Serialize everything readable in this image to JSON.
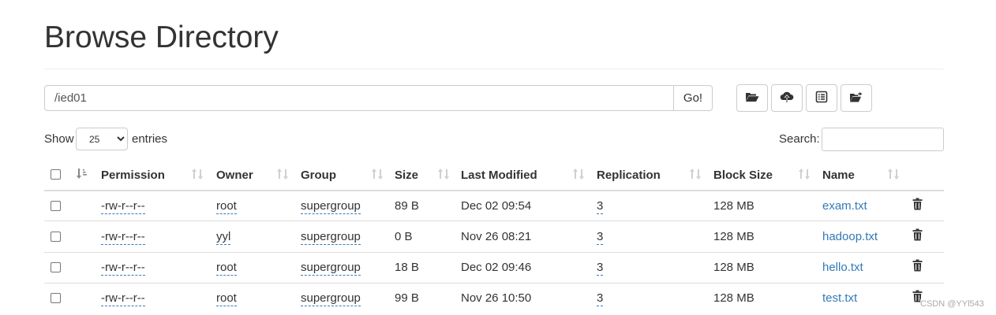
{
  "page": {
    "title": "Browse Directory"
  },
  "toolbar": {
    "path_value": "/ied01",
    "go_label": "Go!",
    "buttons": [
      {
        "name": "create-directory-button",
        "icon": "folder-open-icon"
      },
      {
        "name": "upload-button",
        "icon": "cloud-upload-icon"
      },
      {
        "name": "cut-paste-button",
        "icon": "list-alt-icon"
      },
      {
        "name": "paste-button",
        "icon": "folder-move-icon"
      }
    ]
  },
  "controls": {
    "show_label": "Show",
    "entries_label": "entries",
    "page_length": "25",
    "page_length_options": [
      "25"
    ],
    "search_label": "Search:",
    "search_value": ""
  },
  "table": {
    "headers": {
      "permission": "Permission",
      "owner": "Owner",
      "group": "Group",
      "size": "Size",
      "last_modified": "Last Modified",
      "replication": "Replication",
      "block_size": "Block Size",
      "name": "Name"
    },
    "rows": [
      {
        "permission": "-rw-r--r--",
        "owner": "root",
        "group": "supergroup",
        "size": "89 B",
        "last_modified": "Dec 02 09:54",
        "replication": "3",
        "block_size": "128 MB",
        "name": "exam.txt"
      },
      {
        "permission": "-rw-r--r--",
        "owner": "yyl",
        "group": "supergroup",
        "size": "0 B",
        "last_modified": "Nov 26 08:21",
        "replication": "3",
        "block_size": "128 MB",
        "name": "hadoop.txt"
      },
      {
        "permission": "-rw-r--r--",
        "owner": "root",
        "group": "supergroup",
        "size": "18 B",
        "last_modified": "Dec 02 09:46",
        "replication": "3",
        "block_size": "128 MB",
        "name": "hello.txt"
      },
      {
        "permission": "-rw-r--r--",
        "owner": "root",
        "group": "supergroup",
        "size": "99 B",
        "last_modified": "Nov 26 10:50",
        "replication": "3",
        "block_size": "128 MB",
        "name": "test.txt"
      }
    ]
  },
  "colors": {
    "link": "#337ab7",
    "border": "#cccccc",
    "text": "#333333"
  },
  "watermark": "CSDN @YYl543"
}
